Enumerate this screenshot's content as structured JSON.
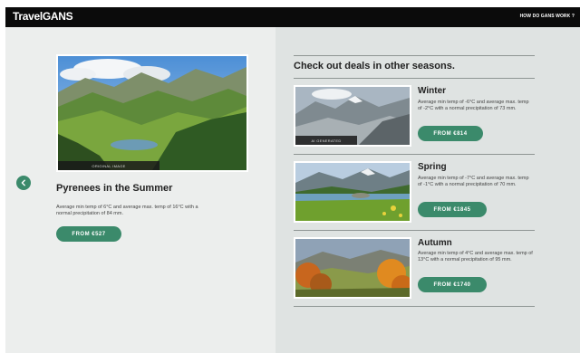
{
  "header": {
    "brand": "TravelGANS",
    "nav_link": "HOW DO GANS WORK ?"
  },
  "main": {
    "image_caption": "ORIGINAL IMAGE",
    "title": "Pyrenees in the Summer",
    "description": "Average min temp of 6°C and average max. temp of 16°C with a normal precipitation of 84 mm.",
    "price_button": "FROM €527"
  },
  "deals": {
    "heading": "Check out deals in other seasons.",
    "items": [
      {
        "season": "Winter",
        "tag": "AI GENERATED",
        "description": "Average min temp of -6°C and average max. temp of -2°C with a normal precipitation of 73 mm.",
        "price": "FROM €814"
      },
      {
        "season": "Spring",
        "tag": "",
        "description": "Average min temp of -7°C and average max. temp of -1°C with a normal precipitation of 70 mm.",
        "price": "FROM €1845"
      },
      {
        "season": "Autumn",
        "tag": "",
        "description": "Average min temp of 4°C and average max. temp of 13°C with a normal precipitation of 95 mm.",
        "price": "FROM €1740"
      }
    ]
  },
  "colors": {
    "accent": "#3b8a6b",
    "header_bg": "#0b0b0b",
    "left_bg": "#eceeed",
    "right_bg": "#dfe3e2"
  },
  "icons": {
    "back": "chevron-left-icon"
  }
}
